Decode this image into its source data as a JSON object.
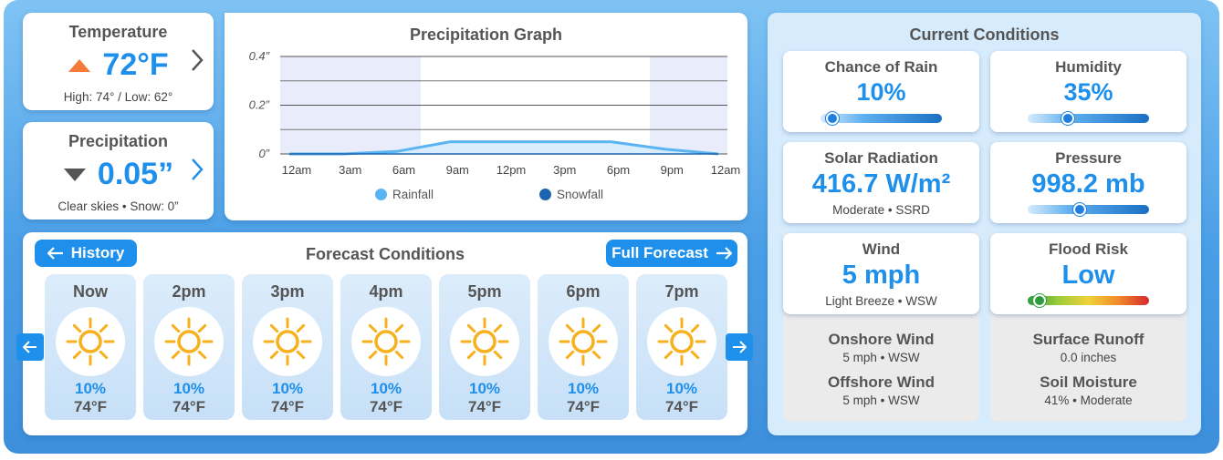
{
  "temperature": {
    "title": "Temperature",
    "value": "72°F",
    "sub": "High: 74° / Low: 62°",
    "trend_icon": "triangle-up-icon",
    "accent": "#f47b3b"
  },
  "precipitation": {
    "title": "Precipitation",
    "value": "0.05”",
    "sub": "Clear skies • Snow: 0”",
    "trend_icon": "triangle-down-icon"
  },
  "graph": {
    "title": "Precipitation Graph",
    "y_ticks": [
      "0.4”",
      "0.2”",
      "0”"
    ],
    "x_ticks": [
      "12am",
      "3am",
      "6am",
      "9am",
      "12pm",
      "3pm",
      "6pm",
      "9pm",
      "12am"
    ],
    "legend": [
      {
        "label": "Rainfall",
        "color": "#5ab4f2"
      },
      {
        "label": "Snowfall",
        "color": "#1c64b0"
      }
    ]
  },
  "chart_data": {
    "type": "line",
    "title": "Precipitation Graph",
    "categories": [
      "12am",
      "3am",
      "6am",
      "9am",
      "12pm",
      "3pm",
      "6pm",
      "9pm",
      "12am"
    ],
    "series": [
      {
        "name": "Rainfall",
        "values": [
          0.0,
          0.0,
          0.01,
          0.05,
          0.05,
          0.05,
          0.05,
          0.02,
          0.0
        ]
      },
      {
        "name": "Snowfall",
        "values": [
          0.0,
          0.0,
          0.0,
          0.0,
          0.0,
          0.0,
          0.0,
          0.0,
          0.0
        ]
      }
    ],
    "ylim": [
      0,
      0.4
    ],
    "grid": true,
    "legend": "bottom"
  },
  "forecast": {
    "title": "Forecast Conditions",
    "history_label": "History",
    "full_label": "Full Forecast",
    "items": [
      {
        "time": "Now",
        "pct": "10%",
        "temp": "74°F"
      },
      {
        "time": "2pm",
        "pct": "10%",
        "temp": "74°F"
      },
      {
        "time": "3pm",
        "pct": "10%",
        "temp": "74°F"
      },
      {
        "time": "4pm",
        "pct": "10%",
        "temp": "74°F"
      },
      {
        "time": "5pm",
        "pct": "10%",
        "temp": "74°F"
      },
      {
        "time": "6pm",
        "pct": "10%",
        "temp": "74°F"
      },
      {
        "time": "7pm",
        "pct": "10%",
        "temp": "74°F"
      }
    ]
  },
  "current": {
    "title": "Current Conditions",
    "rain": {
      "label": "Chance of Rain",
      "value": "10%",
      "level": 0.1
    },
    "humidity": {
      "label": "Humidity",
      "value": "35%",
      "level": 0.33
    },
    "solar": {
      "label": "Solar Radiation",
      "value": "416.7 W/m²",
      "sub": "Moderate • SSRD"
    },
    "pressure": {
      "label": "Pressure",
      "value": "998.2 mb",
      "level": 0.43
    },
    "wind": {
      "label": "Wind",
      "value": "5 mph",
      "sub": "Light Breeze • WSW"
    },
    "flood": {
      "label": "Flood Risk",
      "value": "Low",
      "level": 0.1
    },
    "onshore": {
      "label": "Onshore Wind",
      "sub": "5 mph • WSW"
    },
    "offshore": {
      "label": "Offshore Wind",
      "sub": "5 mph • WSW"
    },
    "runoff": {
      "label": "Surface Runoff",
      "sub": "0.0 inches"
    },
    "soil": {
      "label": "Soil Moisture",
      "sub": "41% • Moderate"
    }
  }
}
